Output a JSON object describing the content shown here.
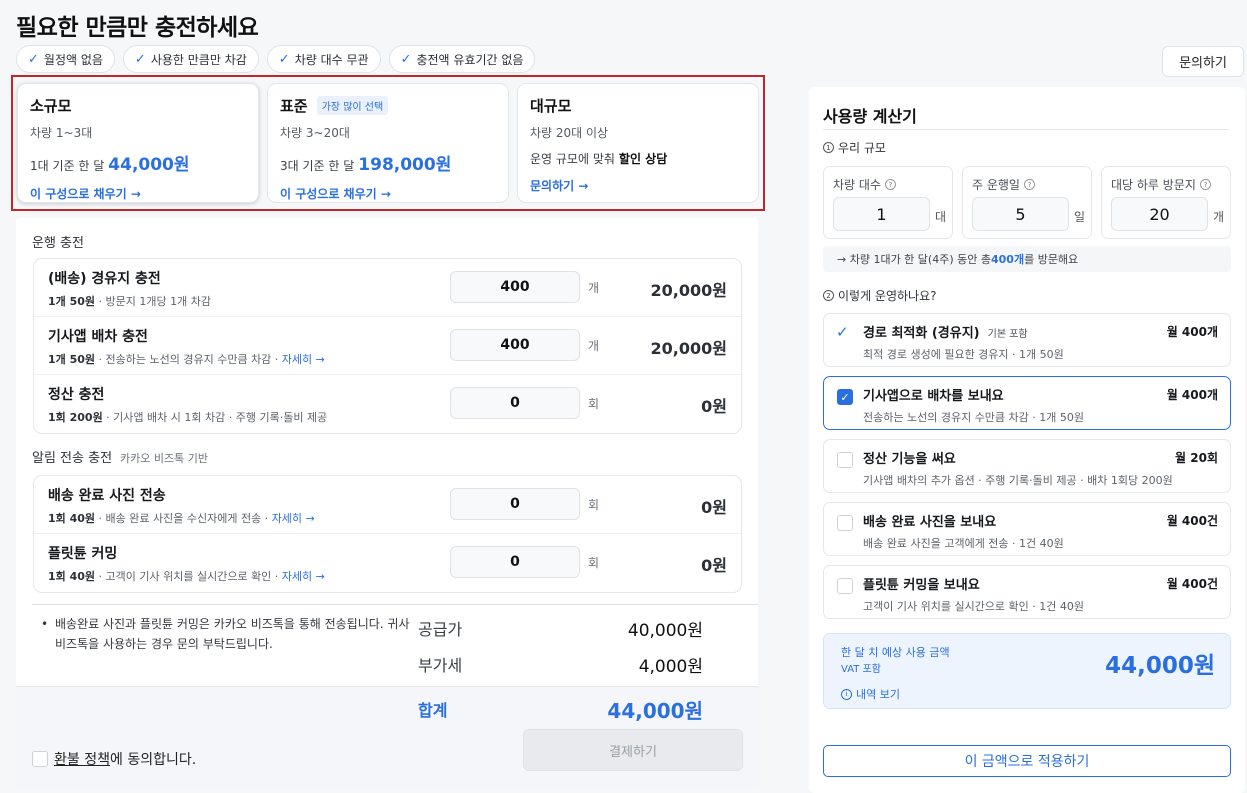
{
  "page": {
    "title": "필요한 만큼만 충전하세요",
    "contact": "문의하기"
  },
  "chips": [
    "월정액 없음",
    "사용한 만큼만 차감",
    "차량 대수 무관",
    "충전액 유효기간 없음"
  ],
  "plans": [
    {
      "name": "소규모",
      "badge": "",
      "range": "차량 1~3대",
      "price_prefix": "1대 기준 한 달",
      "price": "44,000원",
      "link": "이 구성으로 채우기 →"
    },
    {
      "name": "표준",
      "badge": "가장 많이 선택",
      "range": "차량 3~20대",
      "price_prefix": "3대 기준 한 달",
      "price": "198,000원",
      "link": "이 구성으로 채우기 →"
    },
    {
      "name": "대규모",
      "badge": "",
      "range": "차량 20대 이상",
      "price_prefix": "운영 규모에 맞춰",
      "price_strong": "할인 상담",
      "link": "문의하기 →"
    }
  ],
  "operation": {
    "title": "운행 충전",
    "rows": [
      {
        "name": "(배송) 경유지 충전",
        "rate": "1개 50원",
        "desc": " · 방문지 1개당 1개 차감",
        "link": "",
        "qty": "400",
        "unit": "개",
        "total": "20,000원"
      },
      {
        "name": "기사앱 배차 충전",
        "rate": "1개 50원",
        "desc": " · 전송하는 노선의 경유지 수만큼 차감 · ",
        "link": "자세히 →",
        "qty": "400",
        "unit": "개",
        "total": "20,000원"
      },
      {
        "name": "정산 충전",
        "rate": "1회 200원",
        "desc": " · 기사앱 배차 시 1회 차감 · 주행 기록·돌비 제공",
        "link": "",
        "qty": "0",
        "unit": "회",
        "total": "0원"
      }
    ]
  },
  "alimtalk": {
    "title": "알림 전송 충전",
    "subtitle": "카카오 비즈톡 기반",
    "rows": [
      {
        "name": "배송 완료 사진 전송",
        "rate": "1회 40원",
        "desc": " · 배송 완료 사진을 수신자에게 전송 · ",
        "link": "자세히 →",
        "qty": "0",
        "unit": "회",
        "total": "0원"
      },
      {
        "name": "플릿튠 커밍",
        "rate": "1회 40원",
        "desc": " · 고객이 기사 위치를 실시간으로 확인 · ",
        "link": "자세히 →",
        "qty": "0",
        "unit": "회",
        "total": "0원"
      }
    ]
  },
  "summary": {
    "note_bullet": "•",
    "note": "배송완료 사진과 플릿튠 커밍은 카카오 비즈톡을 통해 전송됩니다. 귀사 비즈톡을 사용하는 경우 문의 부탁드립니다.",
    "supply_label": "공급가",
    "supply": "40,000원",
    "vat_label": "부가세",
    "vat": "4,000원",
    "total_label": "합계",
    "total": "44,000원",
    "agree_link": "환불 정책",
    "agree_rest": "에 동의합니다.",
    "pay": "결제하기"
  },
  "calculator": {
    "title": "사용량 계산기",
    "scale_title": "우리 규모",
    "scale_num": "1",
    "params": [
      {
        "label": "차량 대수",
        "value": "1",
        "unit": "대"
      },
      {
        "label": "주 운행일",
        "value": "5",
        "unit": "일"
      },
      {
        "label": "대당 하루 방문지",
        "value": "20",
        "unit": "개"
      }
    ],
    "info_prefix": "→ 차량 1대가 한 달(4주) 동안 총 ",
    "info_value": "400개",
    "info_suffix": "를 방문해요",
    "ops_title": "이렇게 운영하나요?",
    "ops_num": "2",
    "options": [
      {
        "name": "경로 최적화 (경유지)",
        "tag": "기본 포함",
        "desc": "최적 경로 생성에 필요한 경유지 · 1개 50원",
        "amount": "월 400개",
        "state": "included"
      },
      {
        "name": "기사앱으로 배차를 보내요",
        "tag": "",
        "desc": "전송하는 노선의 경유지 수만큼 차감 · 1개 50원",
        "amount": "월 400개",
        "state": "checked"
      },
      {
        "name": "정산 기능을 써요",
        "tag": "",
        "desc": "기사앱 배차의 추가 옵션 · 주행 기록·돌비 제공 · 배차 1회당 200원",
        "amount": "월 20회",
        "state": "unchecked"
      },
      {
        "name": "배송 완료 사진을 보내요",
        "tag": "",
        "desc": "배송 완료 사진을 고객에게 전송 · 1건 40원",
        "amount": "월 400건",
        "state": "unchecked"
      },
      {
        "name": "플릿튠 커밍을 보내요",
        "tag": "",
        "desc": "고객이 기사 위치를 실시간으로 확인 · 1건 40원",
        "amount": "월 400건",
        "state": "unchecked"
      }
    ],
    "estimate_label": "한 달 치 예상 사용 금액",
    "estimate_vat": "VAT 포함",
    "estimate_amount": "44,000원",
    "detail_link": "내역 보기",
    "apply": "이 금액으로 적용하기"
  },
  "colors": {
    "accent": "#2a6fe0",
    "highlight_frame": "#c0272d"
  }
}
